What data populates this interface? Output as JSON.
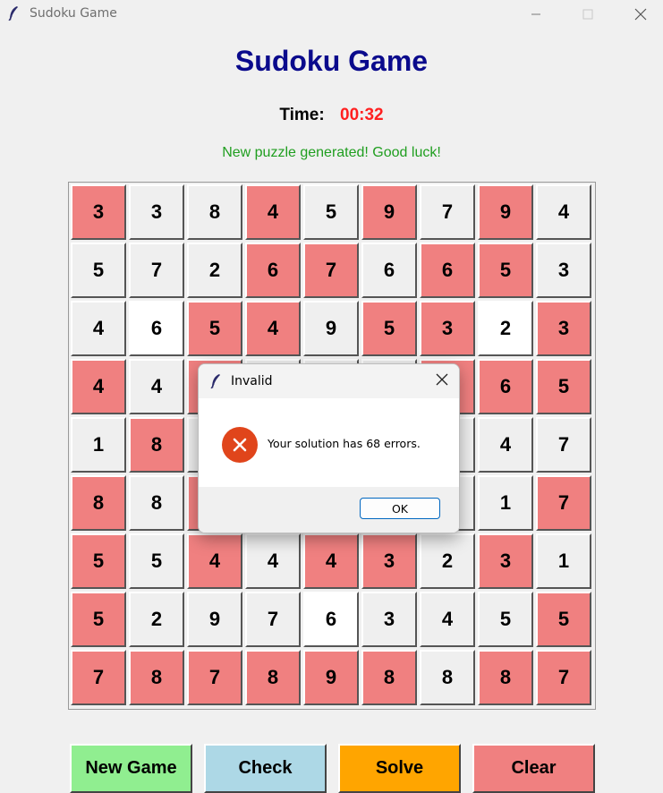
{
  "window": {
    "title": "Sudoku Game"
  },
  "header": {
    "title": "Sudoku Game"
  },
  "timer": {
    "label": "Time:",
    "value": "00:32"
  },
  "status": "New puzzle generated! Good luck!",
  "colors": {
    "error": "#f08080",
    "normal": "#efefef",
    "selected": "#ffffff",
    "title": "#0a0a8c",
    "timer": "#ff2020",
    "status": "#1f9e1f"
  },
  "grid": [
    [
      {
        "v": "3",
        "s": "e"
      },
      {
        "v": "3",
        "s": "n"
      },
      {
        "v": "8",
        "s": "n"
      },
      {
        "v": "4",
        "s": "e"
      },
      {
        "v": "5",
        "s": "n"
      },
      {
        "v": "9",
        "s": "e"
      },
      {
        "v": "7",
        "s": "n"
      },
      {
        "v": "9",
        "s": "e"
      },
      {
        "v": "4",
        "s": "n"
      }
    ],
    [
      {
        "v": "5",
        "s": "n"
      },
      {
        "v": "7",
        "s": "n"
      },
      {
        "v": "2",
        "s": "n"
      },
      {
        "v": "6",
        "s": "e"
      },
      {
        "v": "7",
        "s": "e"
      },
      {
        "v": "6",
        "s": "n"
      },
      {
        "v": "6",
        "s": "e"
      },
      {
        "v": "5",
        "s": "e"
      },
      {
        "v": "3",
        "s": "n"
      }
    ],
    [
      {
        "v": "4",
        "s": "n"
      },
      {
        "v": "6",
        "s": "w"
      },
      {
        "v": "5",
        "s": "e"
      },
      {
        "v": "4",
        "s": "e"
      },
      {
        "v": "9",
        "s": "n"
      },
      {
        "v": "5",
        "s": "e"
      },
      {
        "v": "3",
        "s": "e"
      },
      {
        "v": "2",
        "s": "w"
      },
      {
        "v": "3",
        "s": "e"
      }
    ],
    [
      {
        "v": "4",
        "s": "e"
      },
      {
        "v": "4",
        "s": "n"
      },
      {
        "v": "",
        "s": "e"
      },
      {
        "v": "",
        "s": "n"
      },
      {
        "v": "",
        "s": "n"
      },
      {
        "v": "",
        "s": "n"
      },
      {
        "v": "",
        "s": "e"
      },
      {
        "v": "6",
        "s": "e"
      },
      {
        "v": "5",
        "s": "e"
      }
    ],
    [
      {
        "v": "1",
        "s": "n"
      },
      {
        "v": "8",
        "s": "e"
      },
      {
        "v": "",
        "s": "n"
      },
      {
        "v": "",
        "s": "n"
      },
      {
        "v": "",
        "s": "n"
      },
      {
        "v": "",
        "s": "n"
      },
      {
        "v": "",
        "s": "n"
      },
      {
        "v": "4",
        "s": "n"
      },
      {
        "v": "7",
        "s": "n"
      }
    ],
    [
      {
        "v": "8",
        "s": "e"
      },
      {
        "v": "8",
        "s": "n"
      },
      {
        "v": "",
        "s": "e"
      },
      {
        "v": "",
        "s": "n"
      },
      {
        "v": "",
        "s": "n"
      },
      {
        "v": "",
        "s": "n"
      },
      {
        "v": "",
        "s": "n"
      },
      {
        "v": "1",
        "s": "n"
      },
      {
        "v": "7",
        "s": "e"
      }
    ],
    [
      {
        "v": "5",
        "s": "e"
      },
      {
        "v": "5",
        "s": "n"
      },
      {
        "v": "4",
        "s": "e"
      },
      {
        "v": "4",
        "s": "n"
      },
      {
        "v": "4",
        "s": "e"
      },
      {
        "v": "3",
        "s": "e"
      },
      {
        "v": "2",
        "s": "n"
      },
      {
        "v": "3",
        "s": "e"
      },
      {
        "v": "1",
        "s": "n"
      }
    ],
    [
      {
        "v": "5",
        "s": "e"
      },
      {
        "v": "2",
        "s": "n"
      },
      {
        "v": "9",
        "s": "n"
      },
      {
        "v": "7",
        "s": "n"
      },
      {
        "v": "6",
        "s": "w"
      },
      {
        "v": "3",
        "s": "n"
      },
      {
        "v": "4",
        "s": "n"
      },
      {
        "v": "5",
        "s": "n"
      },
      {
        "v": "5",
        "s": "e"
      }
    ],
    [
      {
        "v": "7",
        "s": "e"
      },
      {
        "v": "8",
        "s": "e"
      },
      {
        "v": "7",
        "s": "e"
      },
      {
        "v": "8",
        "s": "e"
      },
      {
        "v": "9",
        "s": "e"
      },
      {
        "v": "8",
        "s": "e"
      },
      {
        "v": "8",
        "s": "n"
      },
      {
        "v": "8",
        "s": "e"
      },
      {
        "v": "7",
        "s": "e"
      }
    ]
  ],
  "buttons": [
    {
      "name": "new-game-button",
      "label": "New Game",
      "color": "#90ee90"
    },
    {
      "name": "check-button",
      "label": "Check",
      "color": "#add8e6"
    },
    {
      "name": "solve-button",
      "label": "Solve",
      "color": "#ffa500"
    },
    {
      "name": "clear-button",
      "label": "Clear",
      "color": "#f08080"
    }
  ],
  "dialog": {
    "title": "Invalid",
    "icon": "error-icon",
    "message": "Your solution has 68 errors.",
    "ok_label": "OK"
  }
}
